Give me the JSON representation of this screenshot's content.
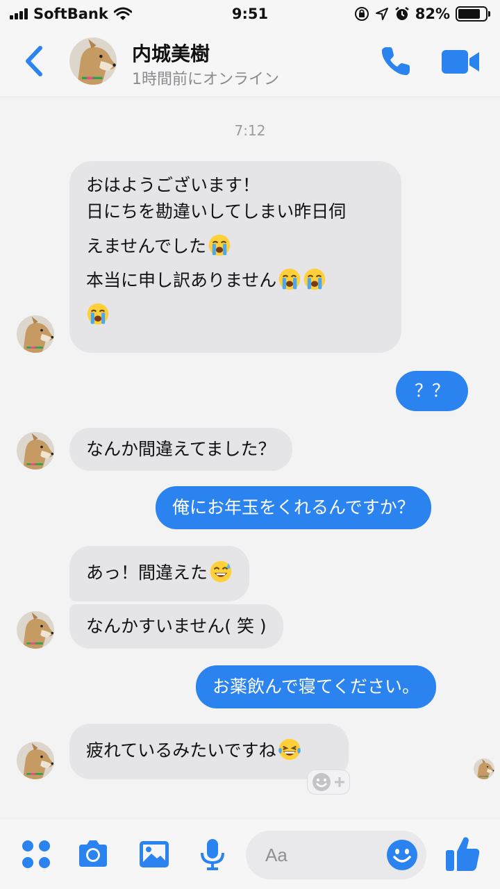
{
  "status_bar": {
    "carrier": "SoftBank",
    "time": "9:51",
    "battery": "82%"
  },
  "header": {
    "contact_name": "内城美樹",
    "contact_status": "1時間前にオンライン",
    "back_icon": "chevron-left-icon",
    "call_icon": "phone-icon",
    "video_icon": "video-camera-icon"
  },
  "conversation": {
    "timestamp": "7:12",
    "messages": [
      {
        "sender": "contact",
        "lines": [
          "おはようございます！",
          "日にちを勘違いしてしまい昨日伺",
          "えませんでした",
          "本当に申し訳ありません",
          ""
        ]
      },
      {
        "sender": "me",
        "text": "？？"
      },
      {
        "sender": "contact",
        "text": "なんか間違えてました？"
      },
      {
        "sender": "me",
        "text": "俺にお年玉をくれるんですか？"
      },
      {
        "sender": "contact",
        "text": "あっ！間違えた"
      },
      {
        "sender": "contact",
        "text": "なんかすいません( 笑 )"
      },
      {
        "sender": "me",
        "text": "お薬飲んで寝てください。"
      },
      {
        "sender": "contact",
        "text": "疲れているみたいですね"
      }
    ]
  },
  "composer": {
    "placeholder": "Aa",
    "icons": [
      "apps-icon",
      "camera-icon",
      "image-icon",
      "microphone-icon",
      "emoji-icon",
      "thumbs-up-icon"
    ]
  },
  "colors": {
    "accent": "#2a83ef",
    "incoming_bubble": "#e5e5e8",
    "background": "#f3f3f4"
  }
}
